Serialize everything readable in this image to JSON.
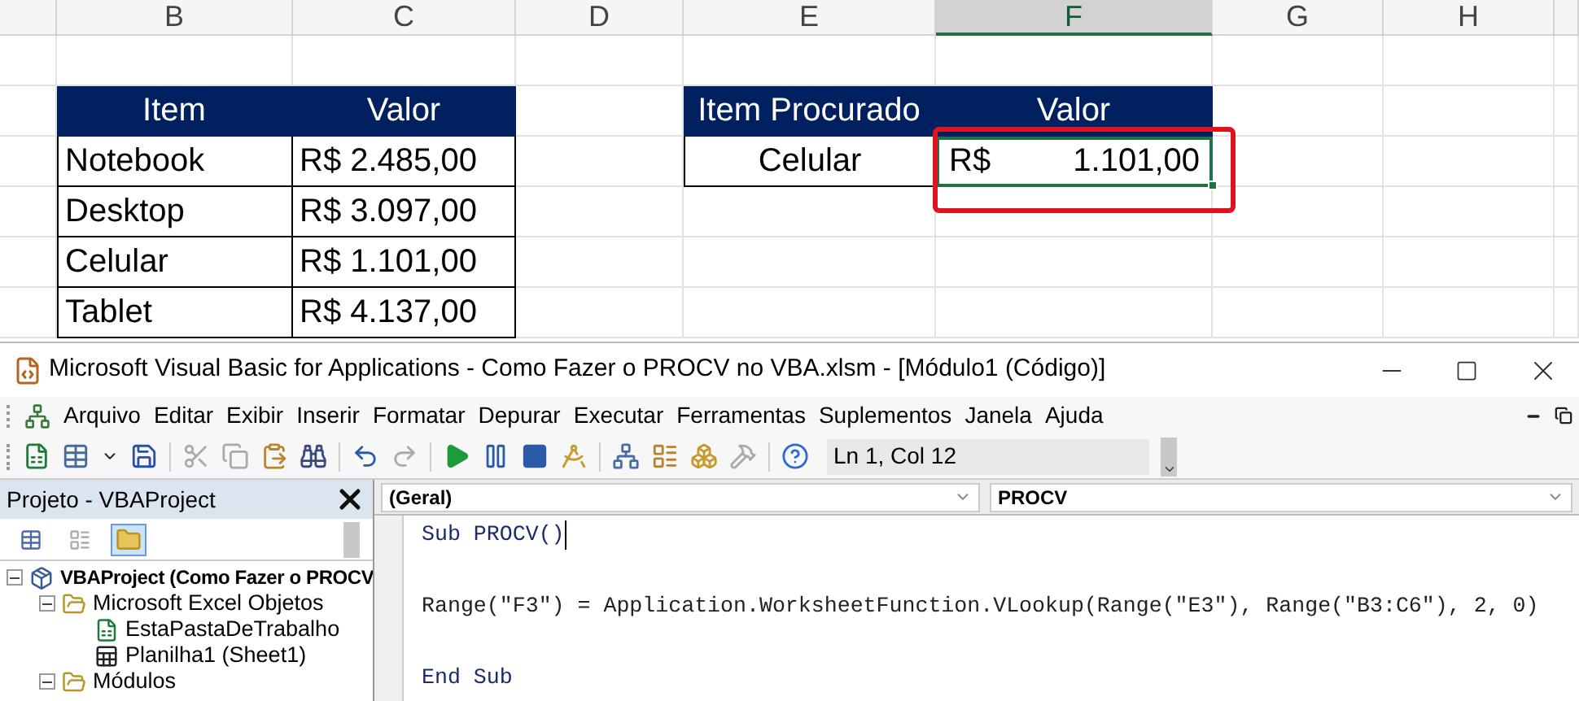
{
  "sheet": {
    "columns": [
      {
        "selected": false
      },
      {
        "label": "B",
        "selected": false
      },
      {
        "label": "C",
        "selected": false
      },
      {
        "label": "D",
        "selected": false
      },
      {
        "label": "E",
        "selected": false
      },
      {
        "label": "F",
        "selected": true
      },
      {
        "label": "G",
        "selected": false
      },
      {
        "label": "H",
        "selected": false
      },
      {
        "selected": false
      }
    ],
    "tables": [
      {
        "header": [
          "Item",
          "Valor"
        ],
        "rows": [
          [
            "Notebook",
            "R$ 2.485,00"
          ],
          [
            "Desktop",
            "R$ 3.097,00"
          ],
          [
            "Celular",
            "R$ 1.101,00"
          ],
          [
            "Tablet",
            "R$ 4.137,00"
          ]
        ]
      },
      {
        "header": [
          "Item Procurado",
          "Valor"
        ],
        "lookup": {
          "item": "Celular",
          "currency": "R$",
          "amount": "1.101,00",
          "selected": true,
          "highlighted": true
        }
      }
    ]
  },
  "vbe": {
    "window": {
      "title": "Microsoft Visual Basic for Applications - Como Fazer o PROCV no VBA.xlsm - [Módulo1 (Código)]"
    },
    "menu": [
      "Arquivo",
      "Editar",
      "Exibir",
      "Inserir",
      "Formatar",
      "Depurar",
      "Executar",
      "Ferramentas",
      "Suplementos",
      "Janela",
      "Ajuda"
    ],
    "toolbar": {
      "position": "Ln 1, Col 12"
    },
    "project": {
      "title": "Projeto - VBAProject",
      "view_buttons": [
        {
          "selected": false
        },
        {
          "selected": false
        },
        {
          "selected": true
        }
      ],
      "tree": [
        {
          "label": "VBAProject (Como Fazer o PROCV",
          "kind": "project",
          "expanded": true,
          "children": [
            {
              "label": "Microsoft Excel Objetos",
              "kind": "folder",
              "expanded": true,
              "children": [
                {
                  "label": "EstaPastaDeTrabalho",
                  "kind": "workbook"
                },
                {
                  "label": "Planilha1 (Sheet1)",
                  "kind": "worksheet"
                }
              ]
            },
            {
              "label": "Módulos",
              "kind": "folder",
              "expanded": true
            }
          ]
        }
      ]
    },
    "code": {
      "object": "(Geral)",
      "procedure": "PROCV",
      "lines": [
        {
          "text": "Sub PROCV()",
          "kind": "keyword",
          "cursor": true
        },
        {
          "text": "Range(\"F3\") = Application.WorksheetFunction.VLookup(Range(\"E3\"), Range(\"B3:C6\"), 2, 0)",
          "kind": "statement",
          "cursor": false
        },
        {
          "text": "End Sub",
          "kind": "keyword",
          "cursor": false
        }
      ]
    }
  }
}
